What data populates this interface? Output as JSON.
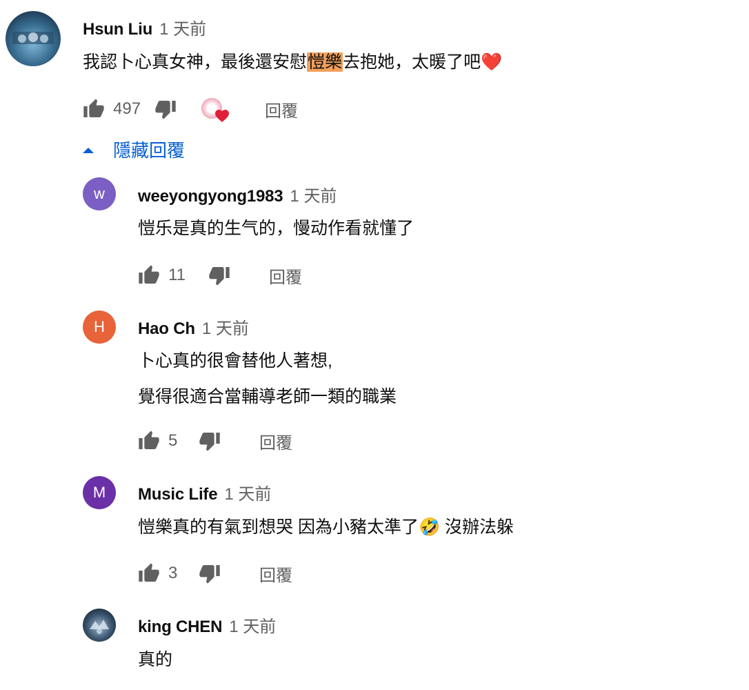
{
  "colors": {
    "highlight": "#f2a05c",
    "link": "#065fd4",
    "meta": "#606060",
    "heart": "#e0203a"
  },
  "top_comment": {
    "author": "Hsun Liu",
    "time": "1 天前",
    "text_before": "我認卜心真女神，最後還安慰",
    "text_highlight": "愷樂",
    "text_after": "去抱她，太暖了吧",
    "emoji": "❤️",
    "likes": "497",
    "reply_label": "回覆",
    "hide_replies_label": "隱藏回覆"
  },
  "replies": [
    {
      "avatar_letter": "w",
      "avatar_color": "#7c5fc4",
      "author": "weeyongyong1983",
      "time": "1 天前",
      "lines": [
        "愷乐是真的生气的，慢动作看就懂了"
      ],
      "likes": "11",
      "reply_label": "回覆"
    },
    {
      "avatar_letter": "H",
      "avatar_color": "#e8633a",
      "author": "Hao Ch",
      "time": "1 天前",
      "lines": [
        "卜心真的很會替他人著想,",
        "覺得很適合當輔導老師一類的職業"
      ],
      "likes": "5",
      "reply_label": "回覆"
    },
    {
      "avatar_letter": "M",
      "avatar_color": "#6b2fa8",
      "author": "Music Life",
      "time": "1 天前",
      "text_before": "愷樂真的有氣到想哭 因為小豬太準了",
      "emoji": "🤣",
      "text_after": " 沒辦法躲",
      "likes": "3",
      "reply_label": "回覆"
    },
    {
      "author": "king CHEN",
      "time": "1 天前",
      "lines": [
        "真的"
      ]
    }
  ]
}
